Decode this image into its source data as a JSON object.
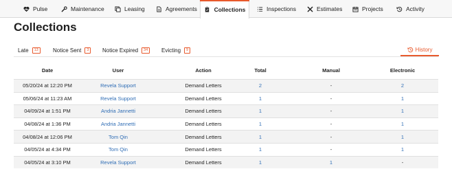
{
  "nav": {
    "tabs": [
      {
        "label": "Pulse",
        "icon": "heart-pulse-icon"
      },
      {
        "label": "Maintenance",
        "icon": "wrench-icon"
      },
      {
        "label": "Leasing",
        "icon": "copy-icon"
      },
      {
        "label": "Agreements",
        "icon": "document-icon"
      },
      {
        "label": "Collections",
        "icon": "clipboard-icon",
        "active": true
      },
      {
        "label": "Inspections",
        "icon": "checklist-icon"
      },
      {
        "label": "Estimates",
        "icon": "tools-icon"
      },
      {
        "label": "Projects",
        "icon": "calendar-icon"
      },
      {
        "label": "Activity",
        "icon": "history-icon"
      }
    ]
  },
  "page": {
    "title": "Collections"
  },
  "subtabs": [
    {
      "label": "Late",
      "count": "13"
    },
    {
      "label": "Notice Sent",
      "count": "3"
    },
    {
      "label": "Notice Expired",
      "count": "34"
    },
    {
      "label": "Evicting",
      "count": "9"
    }
  ],
  "history": {
    "label": "History",
    "icon": "history-icon"
  },
  "table": {
    "headers": {
      "date": "Date",
      "user": "User",
      "action": "Action",
      "total": "Total",
      "manual": "Manual",
      "electronic": "Electronic"
    },
    "rows": [
      {
        "date": "05/20/24 at 12:20 PM",
        "user": "Revela Support",
        "action": "Demand Letters",
        "total": "2",
        "manual": "-",
        "electronic": "2"
      },
      {
        "date": "05/06/24 at 11:23 AM",
        "user": "Revela Support",
        "action": "Demand Letters",
        "total": "1",
        "manual": "-",
        "electronic": "1"
      },
      {
        "date": "04/09/24 at 1:51 PM",
        "user": "Andria Jannetti",
        "action": "Demand Letters",
        "total": "1",
        "manual": "-",
        "electronic": "1"
      },
      {
        "date": "04/08/24 at 1:36 PM",
        "user": "Andria Jannetti",
        "action": "Demand Letters",
        "total": "1",
        "manual": "-",
        "electronic": "1"
      },
      {
        "date": "04/08/24 at 12:06 PM",
        "user": "Tom Qin",
        "action": "Demand Letters",
        "total": "1",
        "manual": "-",
        "electronic": "1"
      },
      {
        "date": "04/05/24 at 4:34 PM",
        "user": "Tom Qin",
        "action": "Demand Letters",
        "total": "1",
        "manual": "-",
        "electronic": "1"
      },
      {
        "date": "04/05/24 at 3:10 PM",
        "user": "Revela Support",
        "action": "Demand Letters",
        "total": "1",
        "manual": "1",
        "electronic": "-"
      }
    ]
  },
  "colors": {
    "accent": "#e8592c",
    "link": "#2f6db5"
  }
}
